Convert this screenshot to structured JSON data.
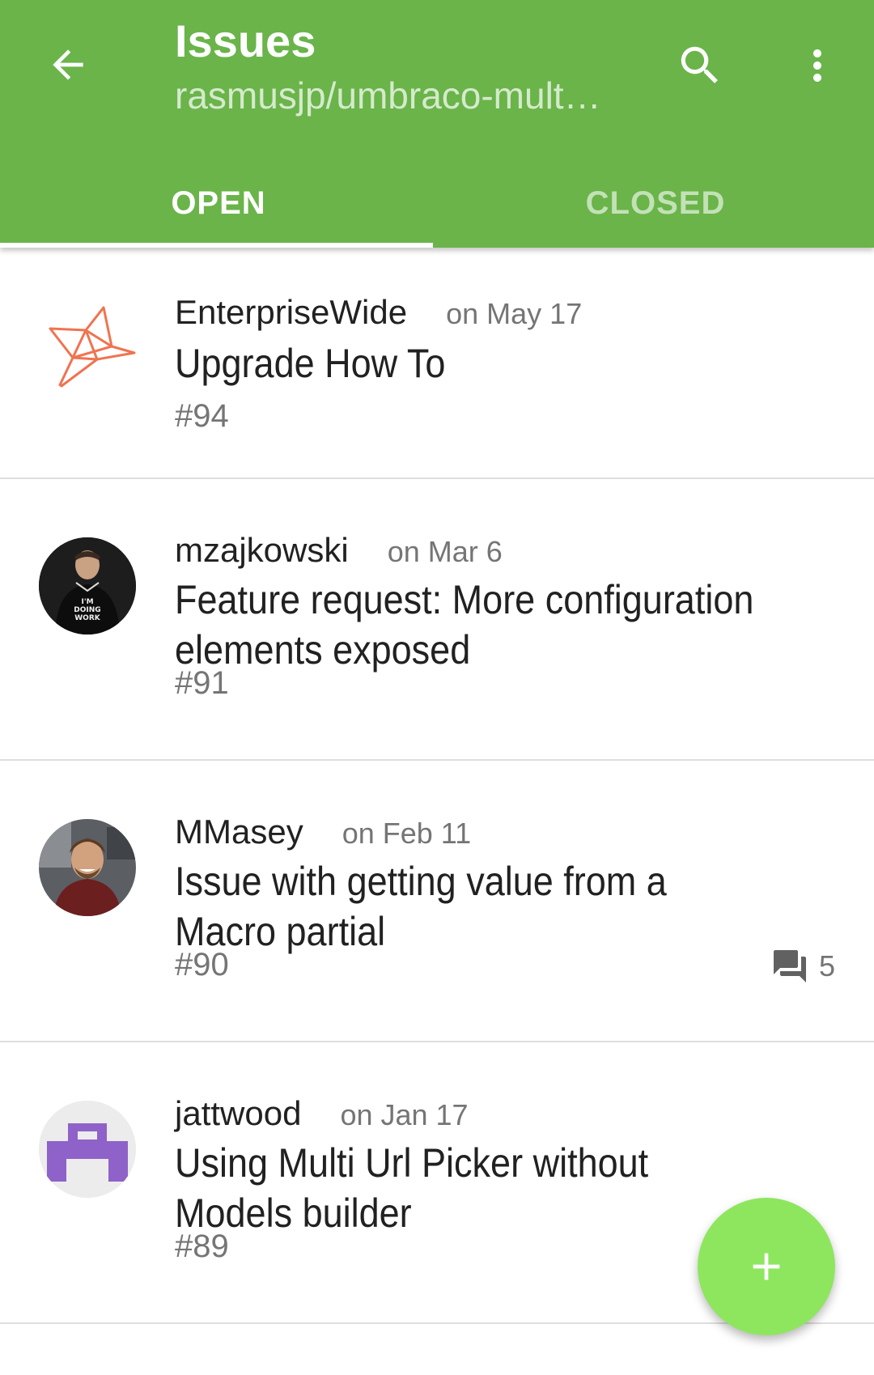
{
  "appbar": {
    "title": "Issues",
    "subtitle": "rasmusjp/umbraco-mult…",
    "back_icon": "arrow-left-icon",
    "search_icon": "search-icon",
    "more_icon": "more-vert-icon",
    "color": "#6ab44a"
  },
  "tabs": [
    {
      "label": "OPEN",
      "active": true
    },
    {
      "label": "CLOSED",
      "active": false
    }
  ],
  "issues": [
    {
      "author": "EnterpriseWide",
      "date": "on May 17",
      "title": "Upgrade How To",
      "number": "#94",
      "avatar": "origami-bird-logo"
    },
    {
      "author": "mzajkowski",
      "date": "on Mar 6",
      "title_line1": "Feature request: More configuration",
      "title_line2": "elements exposed",
      "number": "#91",
      "avatar": "user-photo"
    },
    {
      "author": "MMasey",
      "date": "on Feb 11",
      "title_line1": "Issue with getting value from a",
      "title_line2": "Macro partial",
      "number": "#90",
      "comments": "5",
      "avatar": "user-photo"
    },
    {
      "author": "jattwood",
      "date": "on Jan 17",
      "title_line1": "Using Multi Url Picker without",
      "title_line2": "Models builder",
      "number": "#89",
      "avatar": "identicon"
    }
  ],
  "fab": {
    "icon": "plus-icon",
    "color": "#8ee65f"
  }
}
